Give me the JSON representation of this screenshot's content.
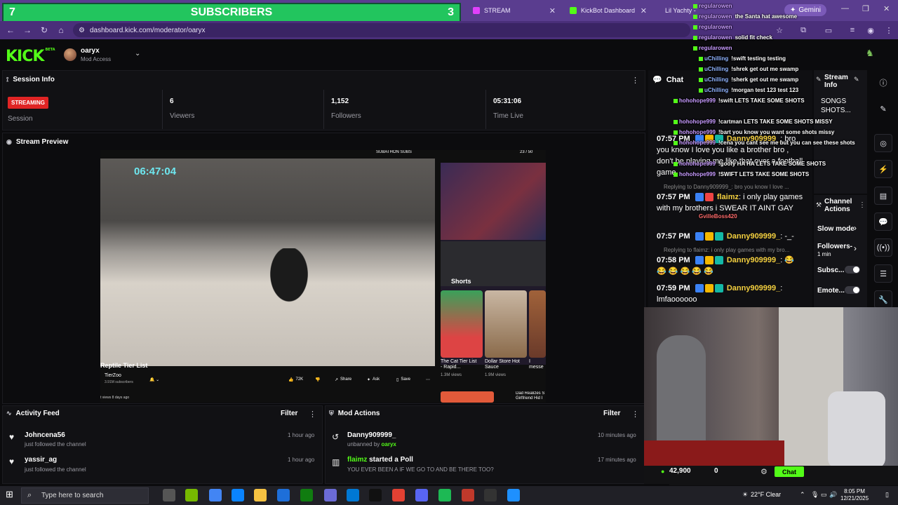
{
  "browser": {
    "subscriber_banner": {
      "left_count": "7",
      "title": "SUBSCRIBERS",
      "right_count": "3"
    },
    "tabs": [
      {
        "label": "STREAM",
        "color": "#e040fb"
      },
      {
        "label": "KickBot Dashboard",
        "color": "#53fc18"
      },
      {
        "label": "Lil Yachty - she ready",
        "color": "#ff0000"
      }
    ],
    "gemini_label": "Gemini",
    "url": "dashboard.kick.com/moderator/oaryx"
  },
  "header": {
    "logo": "KICK",
    "logo_tag": "BETA",
    "username": "oaryx",
    "role": "Mod Access"
  },
  "session_info": {
    "title": "Session Info",
    "status_badge": "STREAMING",
    "session_label": "Session",
    "stats": [
      {
        "value": "6",
        "label": "Viewers"
      },
      {
        "value": "1,152",
        "label": "Followers"
      },
      {
        "value": "05:31:06",
        "label": "Time Live"
      }
    ]
  },
  "stream_preview": {
    "title": "Stream Preview",
    "timer": "06:47:04",
    "subathon_label": "SUBATHON SUBS",
    "subathon_count": "23 / 50",
    "video_title": "Reptile Tier List",
    "channel": "TierZoo",
    "channel_subs": "3.91M subscribers",
    "likes": "72K",
    "share": "Share",
    "ask": "Ask",
    "save": "Save",
    "views_meta": "t views  8 days ago",
    "shorts_label": "Shorts",
    "shorts": [
      {
        "title": "The Cat Tier List - Rapid...",
        "views": "1.3M views"
      },
      {
        "title": "Dollar Store Hot Sauce",
        "views": "1.9M views"
      },
      {
        "title": "I messe",
        "views": ""
      }
    ],
    "bottom_short": "Dad Realizes S Girlfriend Hid I"
  },
  "activity_feed": {
    "title": "Activity Feed",
    "filter": "Filter",
    "items": [
      {
        "name": "Johncena56",
        "sub": "just followed the channel",
        "time": "1 hour ago"
      },
      {
        "name": "yassir_ag",
        "sub": "just followed the channel",
        "time": "1 hour ago"
      }
    ]
  },
  "mod_actions": {
    "title": "Mod Actions",
    "filter": "Filter",
    "items": [
      {
        "name": "Danny909999_",
        "sub_prefix": "unbanned by ",
        "sub_user": "oaryx",
        "time": "10 minutes ago"
      },
      {
        "name": "flaimz",
        "name_suffix": " started a Poll",
        "sub": "YOU EVER BEEN A IF WE GO TO AND BE THERE TOO?",
        "time": "17 minutes ago"
      }
    ]
  },
  "chat": {
    "title": "Chat",
    "messages": [
      {
        "time": "07:57 PM",
        "user": "Danny909999_",
        "text": ": bro you know I love you like a brother bro , don't be playing me like that over a football game"
      },
      {
        "time": "07:57 PM",
        "user": "flaimz",
        "text": ": i only play games with my brothers i SWEAR IT AINT GAY",
        "reply": "Replying to Danny909999_: bro you know I love ..."
      },
      {
        "time": "07:57 PM",
        "user": "Danny909999_",
        "text": ": -_-"
      },
      {
        "time": "07:58 PM",
        "user": "Danny909999_",
        "text": ": 😂 😂 😂 😂 😂 😂",
        "reply": "Replying to flaimz: i only play games with my bro..."
      },
      {
        "time": "07:59 PM",
        "user": "Danny909999_",
        "text": ": lmfaoooooo"
      }
    ]
  },
  "stream_info": {
    "title": "Stream Info",
    "text": "SONGS SHOTS..."
  },
  "channel_actions": {
    "title": "Channel Actions",
    "items": [
      {
        "label": "Slow mode"
      },
      {
        "label": "Followers-",
        "sub": "1 min"
      },
      {
        "label": "Subsc..."
      },
      {
        "label": "Emote..."
      }
    ]
  },
  "webcam_bar": {
    "viewers": "42,900",
    "zero": "0",
    "chat_btn": "Chat"
  },
  "overlay_chat": [
    {
      "user": "regularowen",
      "text": "the Santa hat awesome"
    },
    {
      "user": "regularowen",
      "text": ""
    },
    {
      "user": "regularowen",
      "text": "solid fit check"
    },
    {
      "user": "regularowen",
      "text": ""
    },
    {
      "user": "uChilling",
      "text": "!swift testing testing"
    },
    {
      "user": "uChilling",
      "text": "!shrek get out me swamp"
    },
    {
      "user": "uChilling",
      "text": "!sherk get out me swamp"
    },
    {
      "user": "uChilling",
      "text": "!morgan test 123 test 123"
    },
    {
      "user": "hohohope999",
      "text": "!swift LETS TAKE SOME SHOTS"
    },
    {
      "user": "hohohope999",
      "text": "!cartman LETS TAKE SOME SHOTS MISSY"
    },
    {
      "user": "hohohope999",
      "text": "!bart you know you want some shots missy"
    },
    {
      "user": "hohohope999",
      "text": "!cena you cant see me but you can see these shots"
    },
    {
      "user": "hohohope999",
      "text": "!goofy HA HA LETS TAKE SOME SHOTS"
    },
    {
      "user": "hohohope999",
      "text": "!SWIFT LETS TAKE SOME SHOTS"
    },
    {
      "user": "regularowen",
      "text": ""
    },
    {
      "user": "GvilleBoss420",
      "text": ""
    }
  ],
  "taskbar": {
    "search_placeholder": "Type here to search",
    "weather": "22°F  Clear",
    "time": "8:05 PM",
    "date": "12/21/2025"
  }
}
